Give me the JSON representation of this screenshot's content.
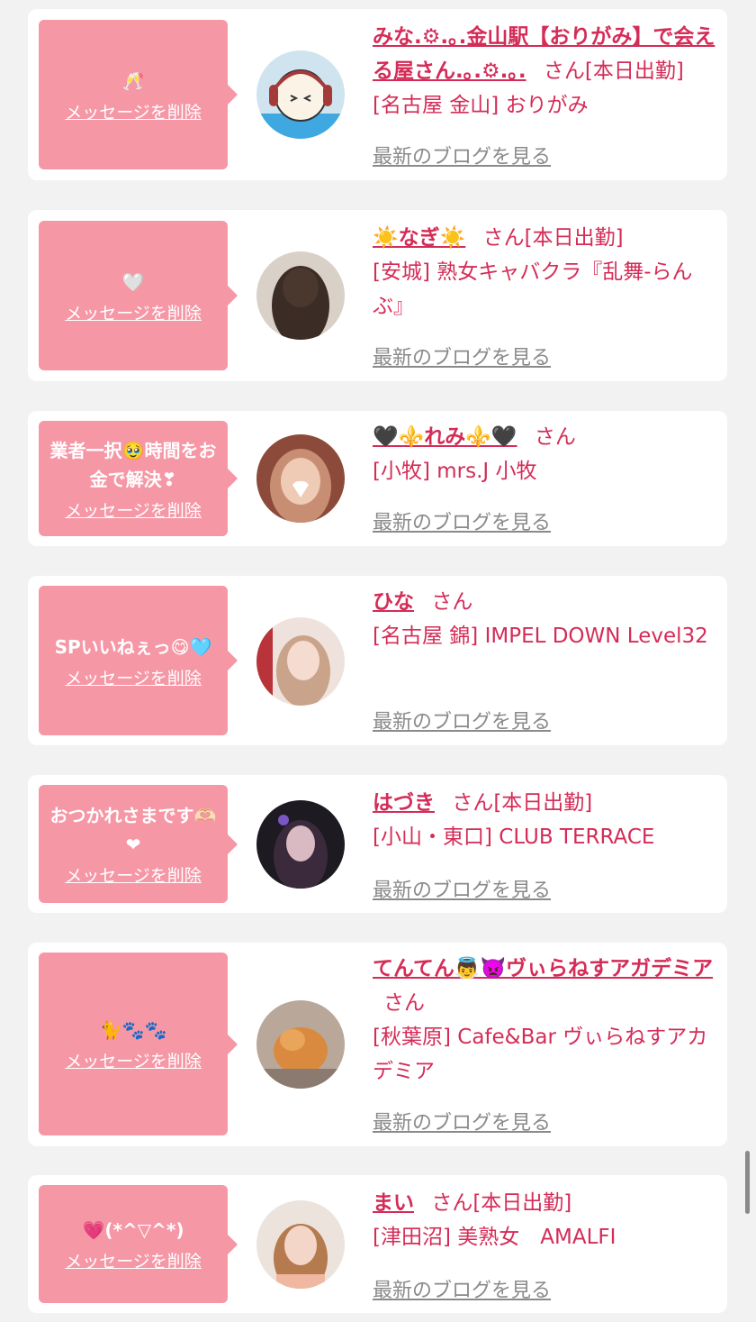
{
  "delete_label": "メッセージを削除",
  "blog_label": "最新のブログを見る",
  "san": "さん",
  "cards": [
    {
      "message": "🥂",
      "name": "みな.⚙.｡.金山駅【おりがみ】で会える屋さん.｡.⚙.｡.",
      "attendance": "[本日出勤]",
      "shop": "[名古屋 金山] おりがみ"
    },
    {
      "message": "🤍",
      "name": "☀️なぎ☀️",
      "attendance": "[本日出勤]",
      "shop": "[安城] 熟女キャバクラ『乱舞-らんぶ』"
    },
    {
      "message": "業者一択🥹時間をお金で解決❣",
      "name": "🖤⚜️れみ⚜️🖤",
      "attendance": "",
      "shop": "[小牧] mrs.J 小牧"
    },
    {
      "message": "SPいいねぇっ😋🩵",
      "name": "ひな",
      "attendance": "",
      "shop": "[名古屋 錦] IMPEL DOWN Level32"
    },
    {
      "message": "おつかれさまです🫶🏻❤",
      "name": "はづき",
      "attendance": "[本日出勤]",
      "shop": "[小山・東口] CLUB TERRACE"
    },
    {
      "message": "🐈🐾🐾",
      "name": "てんてん👼👿ヴぃらねすアガデミア",
      "attendance": "",
      "shop": "[秋葉原] Cafe&Bar ヴぃらねすアカデミア"
    },
    {
      "message": "💗(*^▽^*)",
      "name": "まい",
      "attendance": "[本日出勤]",
      "shop": "[津田沼] 美熟女　AMALFI"
    }
  ]
}
